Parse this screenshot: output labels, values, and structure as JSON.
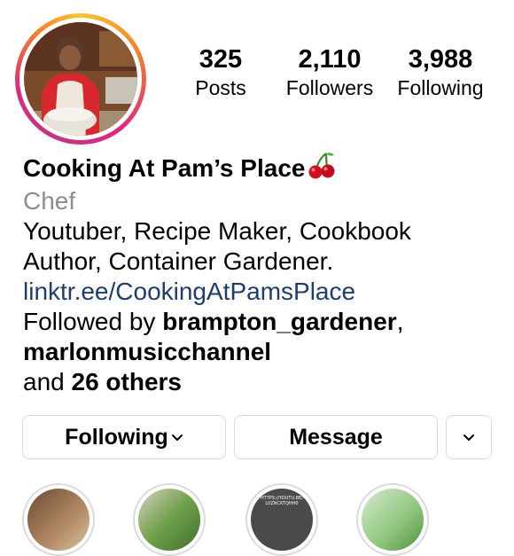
{
  "profile": {
    "name": "Cooking At Pam’s Place",
    "category": "Chef",
    "bio_line1": "Youtuber, Recipe Maker, Cookbook",
    "bio_line2": "Author, Container Gardener.",
    "link": "linktr.ee/CookingAtPamsPlace",
    "followed_by_prefix": "Followed by ",
    "follower1": "brampton_gardener",
    "comma": ",",
    "follower2": "marlonmusicchannel",
    "and_prefix": "and ",
    "others": "26 others"
  },
  "stats": {
    "posts_value": "325",
    "posts_label": "Posts",
    "followers_value": "2,110",
    "followers_label": "Followers",
    "following_value": "3,988",
    "following_label": "Following"
  },
  "actions": {
    "following_label": "Following",
    "message_label": "Message"
  },
  "stories": {
    "story3_text": "HTTPS://YOUTU.BE/ L0ZNCKTQHH0"
  },
  "colors": {
    "link": "#1e3d6e",
    "muted": "#8e8e8e",
    "border": "#dbdbdb"
  },
  "icons": {
    "name_emoji": "cherry-icon",
    "following_chevron": "chevron-down-icon",
    "suggest_chevron": "chevron-down-icon"
  }
}
